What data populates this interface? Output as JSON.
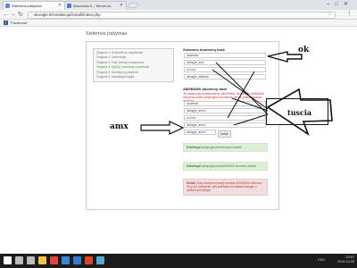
{
  "browser": {
    "tabs": [
      {
        "label": "Sistemos įrašymas",
        "color": "#5b8def"
      },
      {
        "label": "Amonosis.lt – Temos nu",
        "color": "#4a7bd0"
      }
    ],
    "address": "dexagle.lt/instaliacija/install/index.php",
    "bookmark": "\"Facebook\""
  },
  "page": {
    "title": "Sistemos įrašymas",
    "steps": [
      {
        "label": "Žingsnis 1: Sutinkate su taisyklėmis",
        "active": false
      },
      {
        "label": "Žingsnis 2: Informacija",
        "active": false
      },
      {
        "label": "Žingsnis 3: Failų leidimų nustatymas",
        "active": false
      },
      {
        "label": "Žingsnis 4: MySQL duomenų suvedimas",
        "active": true
      },
      {
        "label": "Žingsnis 5: Nustatymų įrašymas",
        "active": false
      },
      {
        "label": "Žingsnis 6: Instaliacija baigta",
        "active": false
      }
    ],
    "db_title": "Sistemos duomenų bazė",
    "db_fields": [
      "localhost",
      "dexagle_amx",
      "•••••••••",
      "dexagle_sistema"
    ],
    "amx_title": "AMXBANS duomenų bazė",
    "amx_desc": "Jei sistema jūs instaliavote su AMXBANS, tai įveskite AMXBANS duomenų bazės prisijungimo duomenis. Jei ne, palikite tuščius laukelius.",
    "amx_fields": [
      "localhost",
      "dexagle_amxx",
      "•••••••••",
      "dexagle_amxx",
      "dexagle_amxx"
    ],
    "submit": "Įrašyti",
    "alert1_bold": "Sėkmingai",
    "alert1_text": "prisijungta prie duomenų bazės!",
    "alert2_bold": "Sėkmingai",
    "alert2_text": "prisijungta prie AMXBANS duomenų bazės!",
    "alert3_bold": "Klaida:",
    "alert3_text": "Jūsų duomenų bazėje nerasta AMXBANS sistemos. Jei ji yra, įsitikinkite, kad prefiksas nurodytas teisingai, o sistema yra įdiegta."
  },
  "annotations": {
    "ok": "ok",
    "amx": "amx",
    "tuscia": "tuscia"
  },
  "taskbar": {
    "time": "03:57",
    "date": "2016.10.03",
    "lang": "ENG",
    "icons": [
      {
        "name": "start",
        "color": "#ffffff"
      },
      {
        "name": "search",
        "color": "#bbbbbb"
      },
      {
        "name": "taskview",
        "color": "#bbbbbb"
      },
      {
        "name": "explorer",
        "color": "#f2c14e"
      },
      {
        "name": "chrome",
        "color": "#e0443e"
      },
      {
        "name": "store",
        "color": "#3a86d4"
      },
      {
        "name": "edge",
        "color": "#2f7bd1"
      },
      {
        "name": "media",
        "color": "#d8452b"
      },
      {
        "name": "app",
        "color": "#5aa6d9"
      }
    ]
  }
}
